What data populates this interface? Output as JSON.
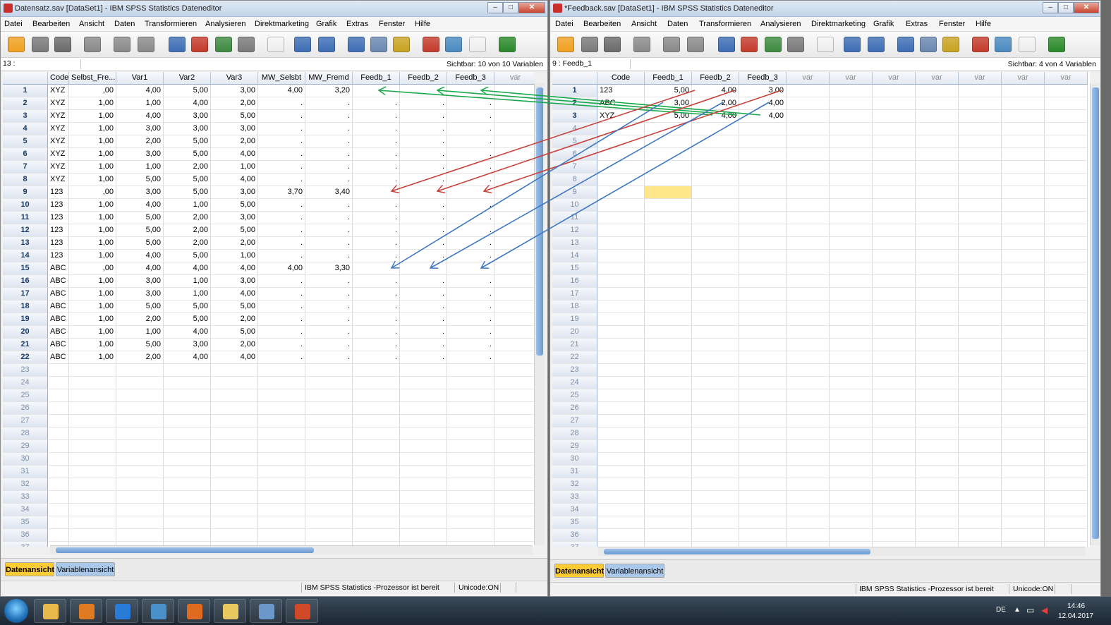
{
  "left_window": {
    "title": "Datensatz.sav [DataSet1] - IBM SPSS Statistics Dateneditor",
    "menu": [
      "Datei",
      "Bearbeiten",
      "Ansicht",
      "Daten",
      "Transformieren",
      "Analysieren",
      "Direktmarketing",
      "Grafik",
      "Extras",
      "Fenster",
      "Hilfe"
    ],
    "cell_ref": "13 :",
    "visible_vars": "Sichtbar: 10 von 10 Variablen",
    "columns": [
      "Code",
      "Selbst_Fre...",
      "Var1",
      "Var2",
      "Var3",
      "MW_Selsbt",
      "MW_Fremd",
      "Feedb_1",
      "Feedb_2",
      "Feedb_3",
      "var"
    ],
    "rows": [
      [
        "XYZ",
        ",00",
        "4,00",
        "5,00",
        "3,00",
        "4,00",
        "3,20",
        "",
        "",
        ""
      ],
      [
        "XYZ",
        "1,00",
        "1,00",
        "4,00",
        "2,00",
        ".",
        ".",
        ".",
        ".",
        "."
      ],
      [
        "XYZ",
        "1,00",
        "4,00",
        "3,00",
        "5,00",
        ".",
        ".",
        ".",
        ".",
        "."
      ],
      [
        "XYZ",
        "1,00",
        "3,00",
        "3,00",
        "3,00",
        ".",
        ".",
        ".",
        ".",
        "."
      ],
      [
        "XYZ",
        "1,00",
        "2,00",
        "5,00",
        "2,00",
        ".",
        ".",
        ".",
        ".",
        "."
      ],
      [
        "XYZ",
        "1,00",
        "3,00",
        "5,00",
        "4,00",
        ".",
        ".",
        ".",
        ".",
        "."
      ],
      [
        "XYZ",
        "1,00",
        "1,00",
        "2,00",
        "1,00",
        ".",
        ".",
        ".",
        ".",
        "."
      ],
      [
        "XYZ",
        "1,00",
        "5,00",
        "5,00",
        "4,00",
        ".",
        ".",
        ".",
        ".",
        "."
      ],
      [
        "123",
        ",00",
        "3,00",
        "5,00",
        "3,00",
        "3,70",
        "3,40",
        "",
        "",
        ""
      ],
      [
        "123",
        "1,00",
        "4,00",
        "1,00",
        "5,00",
        ".",
        ".",
        ".",
        ".",
        "."
      ],
      [
        "123",
        "1,00",
        "5,00",
        "2,00",
        "3,00",
        ".",
        ".",
        ".",
        ".",
        "."
      ],
      [
        "123",
        "1,00",
        "5,00",
        "2,00",
        "5,00",
        ".",
        ".",
        ".",
        ".",
        "."
      ],
      [
        "123",
        "1,00",
        "5,00",
        "2,00",
        "2,00",
        ".",
        ".",
        ".",
        ".",
        "."
      ],
      [
        "123",
        "1,00",
        "4,00",
        "5,00",
        "1,00",
        ".",
        ".",
        ".",
        ".",
        "."
      ],
      [
        "ABC",
        ",00",
        "4,00",
        "4,00",
        "4,00",
        "4,00",
        "3,30",
        "",
        "",
        ""
      ],
      [
        "ABC",
        "1,00",
        "3,00",
        "1,00",
        "3,00",
        ".",
        ".",
        ".",
        ".",
        "."
      ],
      [
        "ABC",
        "1,00",
        "3,00",
        "1,00",
        "4,00",
        ".",
        ".",
        ".",
        ".",
        "."
      ],
      [
        "ABC",
        "1,00",
        "5,00",
        "5,00",
        "5,00",
        ".",
        ".",
        ".",
        ".",
        "."
      ],
      [
        "ABC",
        "1,00",
        "2,00",
        "5,00",
        "2,00",
        ".",
        ".",
        ".",
        ".",
        "."
      ],
      [
        "ABC",
        "1,00",
        "1,00",
        "4,00",
        "5,00",
        ".",
        ".",
        ".",
        ".",
        "."
      ],
      [
        "ABC",
        "1,00",
        "5,00",
        "3,00",
        "2,00",
        ".",
        ".",
        ".",
        ".",
        "."
      ],
      [
        "ABC",
        "1,00",
        "2,00",
        "4,00",
        "4,00",
        ".",
        ".",
        ".",
        ".",
        "."
      ]
    ],
    "total_row_numbers": 37,
    "tab_data": "Datenansicht",
    "tab_vars": "Variablenansicht",
    "status": "IBM SPSS Statistics -Prozessor ist bereit",
    "unicode": "Unicode:ON"
  },
  "right_window": {
    "title": "*Feedback.sav [DataSet1] - IBM SPSS Statistics Dateneditor",
    "menu": [
      "Datei",
      "Bearbeiten",
      "Ansicht",
      "Daten",
      "Transformieren",
      "Analysieren",
      "Direktmarketing",
      "Grafik",
      "Extras",
      "Fenster",
      "Hilfe"
    ],
    "cell_ref": "9 : Feedb_1",
    "visible_vars": "Sichtbar: 4 von 4 Variablen",
    "columns": [
      "Code",
      "Feedb_1",
      "Feedb_2",
      "Feedb_3",
      "var",
      "var",
      "var",
      "var",
      "var",
      "var",
      "var"
    ],
    "rows": [
      [
        "123",
        "5,00",
        "4,00",
        "3,00"
      ],
      [
        "ABC",
        "3,00",
        "2,00",
        "4,00"
      ],
      [
        "XYZ",
        "5,00",
        "4,00",
        "4,00"
      ]
    ],
    "total_row_numbers": 37,
    "tab_data": "Datenansicht",
    "tab_vars": "Variablenansicht",
    "status": "IBM SPSS Statistics -Prozessor ist bereit",
    "unicode": "Unicode:ON"
  },
  "taskbar": {
    "lang": "DE",
    "time": "14:46",
    "date": "12.04.2017",
    "apps": [
      "explorer",
      "media-player",
      "internet-explorer",
      "thunderbird",
      "firefox",
      "folder",
      "spss",
      "powerpoint"
    ]
  },
  "colors": {
    "arrow_green": "#19a84a",
    "arrow_red": "#c8413a",
    "arrow_blue": "#3f78c0",
    "active_tab": "#ffcc33",
    "selected_cell": "#ffe68a"
  }
}
